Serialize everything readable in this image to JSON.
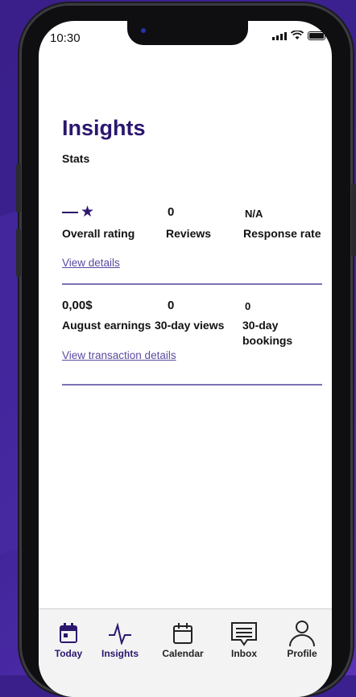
{
  "status": {
    "time": "10:30"
  },
  "header": {
    "title": "Insights",
    "subtitle": "Stats"
  },
  "stats_row1": {
    "rating": {
      "value": "—★",
      "label": "Overall rating"
    },
    "reviews": {
      "value": "0",
      "label": "Reviews"
    },
    "response": {
      "value": "N/A",
      "label": "Response rate"
    },
    "link": "View details"
  },
  "stats_row2": {
    "earnings": {
      "value": "0,00$",
      "label": "August earnings"
    },
    "views": {
      "value": "0",
      "label": "30-day views"
    },
    "bookings": {
      "value": "0",
      "label_line1": "30-day",
      "label_line2": "bookings"
    },
    "link": "View transaction details"
  },
  "tabs": [
    {
      "label": "Today",
      "icon": "calendar-today-icon"
    },
    {
      "label": "Insights",
      "icon": "pulse-icon"
    },
    {
      "label": "Calendar",
      "icon": "calendar-icon"
    },
    {
      "label": "Inbox",
      "icon": "inbox-message-icon"
    },
    {
      "label": "Profile",
      "icon": "user-icon"
    }
  ],
  "colors": {
    "accent": "#2b176e",
    "link": "#5b4aa0",
    "divider": "#7d70b5"
  }
}
